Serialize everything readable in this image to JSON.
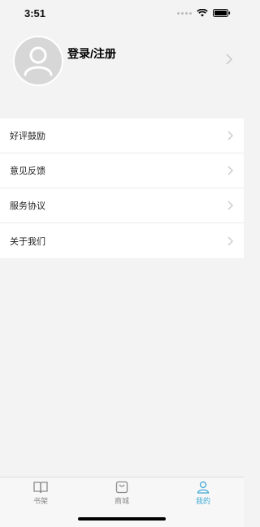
{
  "status_bar": {
    "time": "3:51"
  },
  "header": {
    "login_label": "登录/注册"
  },
  "menu": {
    "items": [
      {
        "label": "好评鼓励"
      },
      {
        "label": "意见反馈"
      },
      {
        "label": "服务协议"
      },
      {
        "label": "关于我们"
      }
    ]
  },
  "tab_bar": {
    "tabs": [
      {
        "label": "书架",
        "icon": "book-icon",
        "active": false
      },
      {
        "label": "商城",
        "icon": "shopping-bag-icon",
        "active": false
      },
      {
        "label": "我的",
        "icon": "person-icon",
        "active": true
      }
    ]
  },
  "colors": {
    "accent": "#3fa9d6",
    "background": "#f3f3f3"
  }
}
